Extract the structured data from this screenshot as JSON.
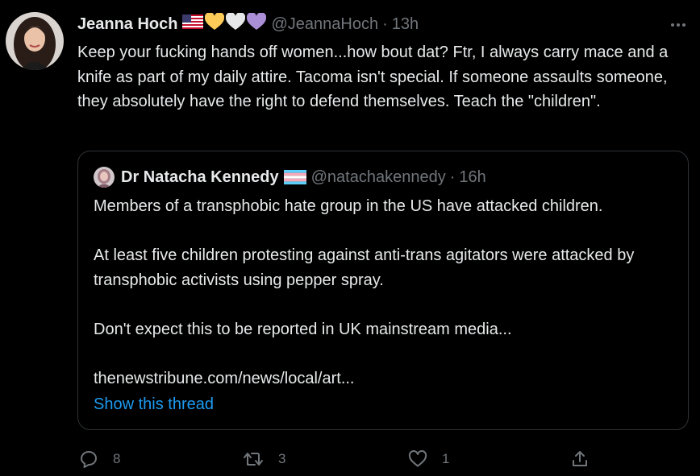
{
  "tweet": {
    "author_name": "Jeanna Hoch",
    "author_handle": "@JeannaHoch",
    "separator": "·",
    "time": "13h",
    "emojis": [
      "flag-us-icon",
      "yellow-heart-icon",
      "white-heart-icon",
      "purple-heart-icon"
    ],
    "text": "Keep your fucking hands off women...how bout dat? Ftr, I always carry mace and a knife as part of my daily attire. Tacoma isn't special. If someone assaults someone, they absolutely have the right to defend themselves. Teach the \"children\"."
  },
  "quote": {
    "author_name": "Dr Natacha Kennedy",
    "author_handle": "@natachakennedy",
    "separator": "·",
    "time": "16h",
    "flag": "transgender-flag-icon",
    "paragraphs": [
      "Members of a transphobic hate group in the US have attacked children.",
      "At least five children protesting against anti-trans agitators were attacked by transphobic activists using pepper spray.",
      "Don't expect this to be reported in UK mainstream media...",
      "thenewstribune.com/news/local/art..."
    ],
    "show_thread": "Show this thread"
  },
  "actions": {
    "replies": "8",
    "retweets": "3",
    "likes": "1"
  },
  "colors": {
    "background": "#000000",
    "text": "#e7e9ea",
    "muted": "#71767b",
    "link": "#1d9bf0",
    "border": "#2f3336"
  }
}
